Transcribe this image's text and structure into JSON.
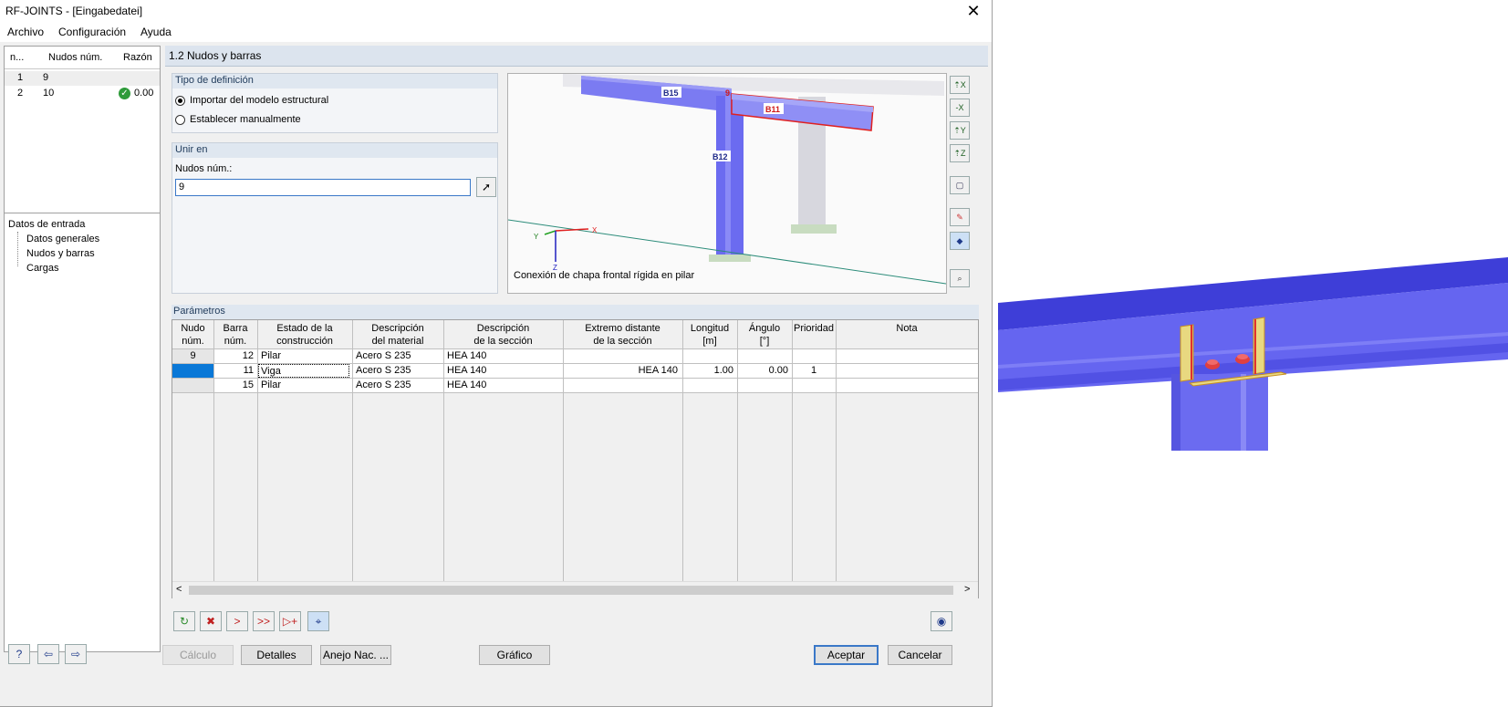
{
  "window": {
    "title": "RF-JOINTS - [Eingabedatei]"
  },
  "menu": [
    "Archivo",
    "Configuración",
    "Ayuda"
  ],
  "joints_list": {
    "headers": {
      "no": "n...",
      "nodes": "Nudos núm.",
      "ratio": "Razón"
    },
    "rows": [
      {
        "no": "1",
        "nodes": "9",
        "ratio": ""
      },
      {
        "no": "2",
        "nodes": "10",
        "ratio": "0.00"
      }
    ]
  },
  "navigator": {
    "root": "Datos de entrada",
    "items": [
      "Datos generales",
      "Nudos y barras",
      "Cargas"
    ]
  },
  "section_title": "1.2 Nudos y barras",
  "definition_type": {
    "title": "Tipo de definición",
    "option_import": "Importar del modelo estructural",
    "option_manual": "Establecer manualmente",
    "selected": "import"
  },
  "connect_at": {
    "title": "Unir en",
    "nodes_label": "Nudos núm.:",
    "nodes_value": "9"
  },
  "preview": {
    "caption": "Conexión de chapa frontal rígida en pilar",
    "labels": {
      "b15": "B15",
      "b11": "B11",
      "b12": "B12",
      "node": "9"
    },
    "axes": {
      "x": "X",
      "y": "Y",
      "z": "Z"
    }
  },
  "parameters": {
    "title": "Parámetros",
    "columns": [
      [
        "Nudo",
        "núm."
      ],
      [
        "Barra",
        "núm."
      ],
      [
        "Estado de la",
        "construcción"
      ],
      [
        "Descripción",
        "del material"
      ],
      [
        "Descripción",
        "de la sección"
      ],
      [
        "Extremo distante",
        "de la sección"
      ],
      [
        "Longitud",
        "[m]"
      ],
      [
        "Ángulo",
        "[°]"
      ],
      [
        "",
        "Prioridad"
      ],
      [
        "",
        "Nota"
      ]
    ],
    "rows": [
      {
        "node": "9",
        "member": "12",
        "state": "Pilar",
        "material": "Acero S 235",
        "section": "HEA 140",
        "far_end": "",
        "length": "",
        "angle": "",
        "priority": "",
        "note": ""
      },
      {
        "node": "",
        "member": "11",
        "state": "Viga",
        "material": "Acero S 235",
        "section": "HEA 140",
        "far_end": "HEA 140",
        "length": "1.00",
        "angle": "0.00",
        "priority": "1",
        "note": ""
      },
      {
        "node": "",
        "member": "15",
        "state": "Pilar",
        "material": "Acero S 235",
        "section": "HEA 140",
        "far_end": "",
        "length": "",
        "angle": "",
        "priority": "",
        "note": ""
      }
    ]
  },
  "buttons": {
    "calc": "Cálculo",
    "details": "Detalles",
    "annex": "Anejo Nac. ...",
    "graphic": "Gráfico",
    "ok": "Aceptar",
    "cancel": "Cancelar"
  },
  "colors": {
    "steel": "#6b6bf0",
    "highlight": "#e02020",
    "header": "#dce4ee"
  }
}
